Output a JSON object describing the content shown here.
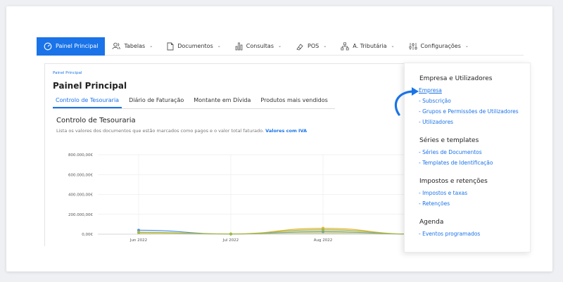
{
  "nav": {
    "items": [
      {
        "label": "Painel Principal",
        "icon": "dashboard-icon",
        "active": true,
        "dropdown": false
      },
      {
        "label": "Tabelas",
        "icon": "users-icon",
        "active": false,
        "dropdown": true
      },
      {
        "label": "Documentos",
        "icon": "document-icon",
        "active": false,
        "dropdown": true
      },
      {
        "label": "Consultas",
        "icon": "bar-chart-icon",
        "active": false,
        "dropdown": true
      },
      {
        "label": "POS",
        "icon": "pos-icon",
        "active": false,
        "dropdown": true
      },
      {
        "label": "A. Tributária",
        "icon": "network-icon",
        "active": false,
        "dropdown": true
      },
      {
        "label": "Configurações",
        "icon": "sliders-icon",
        "active": false,
        "dropdown": true
      }
    ],
    "chevron": "⌄",
    "accent": "#1a73e8"
  },
  "page": {
    "breadcrumb": "Painel Principal",
    "title": "Painel Principal",
    "tabs": [
      "Controlo de Tesouraria",
      "Diário de Faturação",
      "Montante em Dívida",
      "Produtos mais vendidos"
    ],
    "active_tab": 0,
    "section_title": "Controlo de Tesouraria",
    "section_desc": "Lista os valores dos documentos que estão marcados como pagos e o valor total faturado.",
    "section_link": "Valores com IVA"
  },
  "dropdown": {
    "groups": [
      {
        "title": "Empresa e Utilizadores",
        "items": [
          "Empresa",
          "- Subscrição",
          "- Grupos e Permissões de Utilizadores",
          "- Utilizadores"
        ]
      },
      {
        "title": "Séries e templates",
        "items": [
          "- Séries de Documentos",
          "- Templates de Identificação"
        ]
      },
      {
        "title": "Impostos e retenções",
        "items": [
          "- Impostos e taxas",
          "- Retenções"
        ]
      },
      {
        "title": "Agenda",
        "items": [
          "- Eventos programados"
        ]
      }
    ]
  },
  "chart_data": {
    "type": "area",
    "title": "",
    "categories": [
      "Jun 2022",
      "Jul 2022",
      "Aug 2022"
    ],
    "yticks": [
      "0,00€",
      "200.000,00€",
      "400.000,00€",
      "600.000,00€",
      "800.000,00€"
    ],
    "ylim": [
      0,
      800000
    ],
    "grid": true,
    "series": [
      {
        "color": "#4a90e2",
        "points": [
          [
            0,
            40000
          ],
          [
            1,
            2000
          ],
          [
            2,
            25000
          ],
          [
            3,
            0
          ]
        ]
      },
      {
        "color": "#e8b430",
        "points": [
          [
            0,
            20000
          ],
          [
            1,
            3000
          ],
          [
            2,
            60000
          ],
          [
            3,
            0
          ]
        ]
      },
      {
        "color": "#9dbb4f",
        "points": [
          [
            0,
            15000
          ],
          [
            1,
            2000
          ],
          [
            2,
            45000
          ],
          [
            3,
            0
          ]
        ]
      }
    ]
  }
}
